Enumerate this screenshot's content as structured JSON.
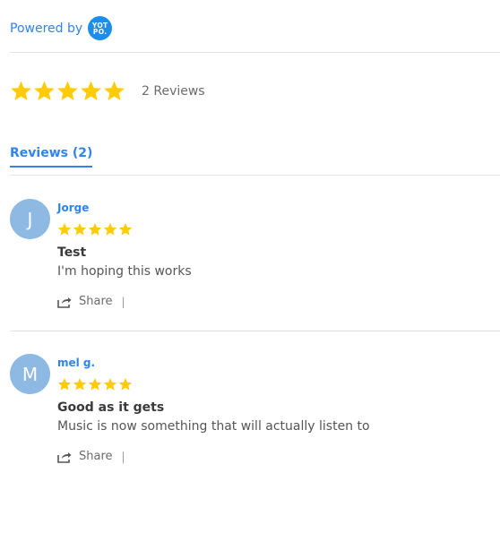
{
  "powered_by": {
    "label": "Powered by",
    "logo_text_line1": "YOT",
    "logo_text_line2": "PO."
  },
  "summary": {
    "rating": 5,
    "count_label": "2 Reviews"
  },
  "tabs": [
    {
      "label": "Reviews (2)"
    }
  ],
  "colors": {
    "accent": "#2f84ed",
    "star": "#ffcb05",
    "avatar_bg": "#8db9e2",
    "divider": "#e3e3e3"
  },
  "reviews": [
    {
      "avatar_initial": "J",
      "author": "Jorge",
      "rating": 5,
      "title": "Test",
      "body": "I'm hoping this works",
      "share_label": "Share",
      "separator": "|"
    },
    {
      "avatar_initial": "M",
      "author": "mel g.",
      "rating": 5,
      "title": "Good as it gets",
      "body": "Music is now something that will actually listen to",
      "share_label": "Share",
      "separator": "|"
    }
  ]
}
